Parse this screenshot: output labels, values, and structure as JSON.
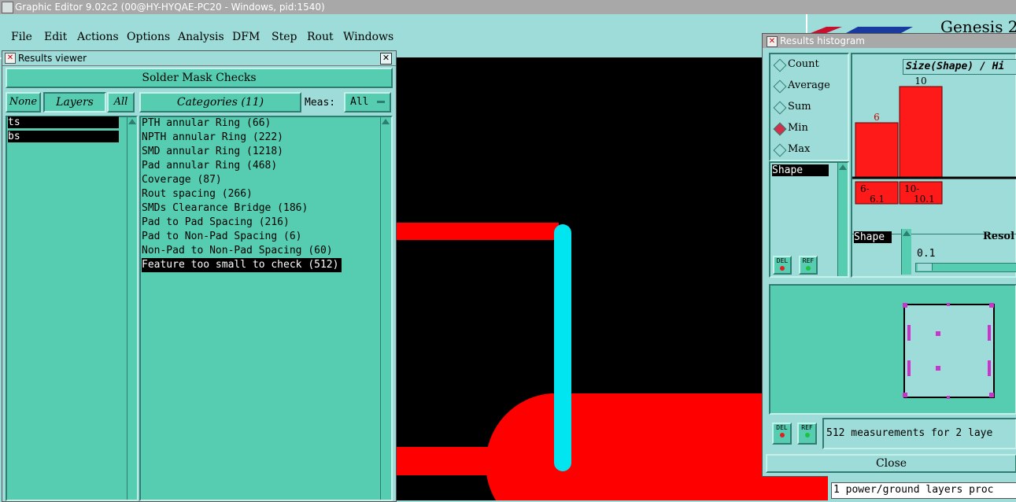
{
  "app": {
    "title": "Graphic Editor 9.02c2 (00@HY-HYQAE-PC20 - Windows, pid:1540)",
    "genesis_title": "Genesis 2"
  },
  "menu": [
    "File",
    "Edit",
    "Actions",
    "Options",
    "Analysis",
    "DFM",
    "Step",
    "Rout",
    "Windows"
  ],
  "results_viewer": {
    "title": "Results viewer",
    "check_name": "Solder Mask Checks",
    "none_label": "None",
    "layers_label": "Layers",
    "all_label": "All",
    "layers": [
      "ts",
      "bs"
    ],
    "categories_label": "Categories (11)",
    "meas_label": "Meas:",
    "meas_value": "All",
    "categories": [
      "PTH annular Ring (66)",
      "NPTH annular Ring (222)",
      "SMD annular Ring (1218)",
      "Pad annular Ring (468)",
      "Coverage (87)",
      "Rout spacing (266)",
      "SMDs Clearance Bridge (186)",
      "Pad to Pad Spacing (216)",
      "Pad to Non-Pad Spacing (6)",
      "Non-Pad to Non-Pad Spacing (60)",
      "Feature too small to check (512)"
    ],
    "selected_category_index": 10
  },
  "histogram": {
    "title": "Results histogram",
    "modes": [
      "Count",
      "Average",
      "Sum",
      "Min",
      "Max"
    ],
    "selected_mode": "Min",
    "chart_title": "Size(Shape) / Hi",
    "shape_label": "Shape",
    "bins": [
      {
        "label_top": "6-",
        "label_bottom": "6.1",
        "value": 6
      },
      {
        "label_top": "10-",
        "label_bottom": "10.1",
        "value": 10
      }
    ],
    "resolution_label": "Resol",
    "resolution_value": "0.1",
    "del_label": "DEL",
    "ref_label": "REF",
    "status_text": "512 measurements for 2 laye",
    "close_label": "Close"
  },
  "bottom_status": "1 power/ground layers proc",
  "colors": {
    "panel_bg": "#9ddcd8",
    "list_bg": "#56cdb0",
    "feature_red": "#ff0000",
    "feature_cyan": "#00e5f0",
    "selection_magenta": "#cc33cc"
  }
}
